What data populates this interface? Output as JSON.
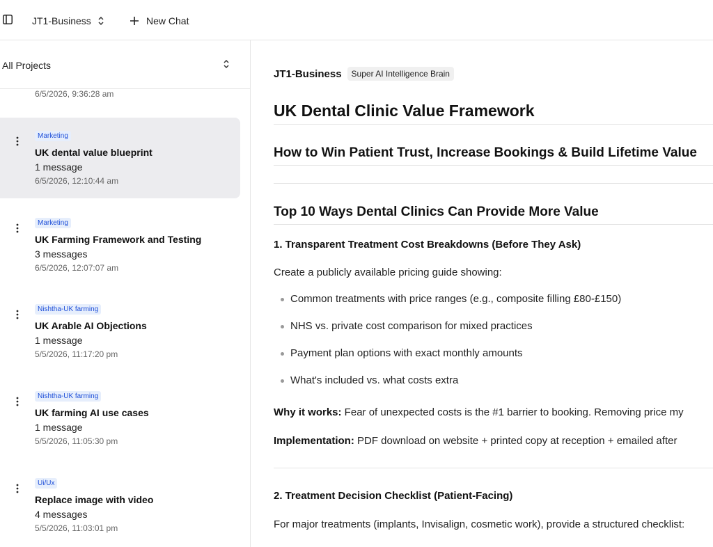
{
  "topbar": {
    "workspace": "JT1-Business",
    "new_chat_label": "New Chat"
  },
  "sidebar": {
    "project_filter": "All Projects",
    "top_partial_timestamp": "6/5/2026, 9:36:28 am",
    "items": [
      {
        "tag": "Marketing",
        "title": "UK dental value blueprint",
        "count": "1 message",
        "timestamp": "6/5/2026, 12:10:44 am",
        "selected": true
      },
      {
        "tag": "Marketing",
        "title": "UK Farming Framework and Testing",
        "count": "3 messages",
        "timestamp": "6/5/2026, 12:07:07 am",
        "selected": false
      },
      {
        "tag": "Nishtha-UK farming",
        "title": "UK Arable AI Objections",
        "count": "1 message",
        "timestamp": "5/5/2026, 11:17:20 pm",
        "selected": false
      },
      {
        "tag": "Nishtha-UK farming",
        "title": "UK farming AI use cases",
        "count": "1 message",
        "timestamp": "5/5/2026, 11:05:30 pm",
        "selected": false
      },
      {
        "tag": "Ui/Ux",
        "title": "Replace image with video",
        "count": "4 messages",
        "timestamp": "5/5/2026, 11:03:01 pm",
        "selected": false
      }
    ]
  },
  "main": {
    "workspace_name": "JT1-Business",
    "workspace_badge": "Super AI Intelligence Brain",
    "title": "UK Dental Clinic Value Framework",
    "subtitle": "How to Win Patient Trust, Increase Bookings & Build Lifetime Value",
    "section_heading": "Top 10 Ways Dental Clinics Can Provide More Value",
    "item1": {
      "heading": "1. Transparent Treatment Cost Breakdowns (Before They Ask)",
      "intro": "Create a publicly available pricing guide showing:",
      "bullets": [
        "Common treatments with price ranges (e.g., composite filling £80-£150)",
        "NHS vs. private cost comparison for mixed practices",
        "Payment plan options with exact monthly amounts",
        "What's included vs. what costs extra"
      ],
      "why_label": "Why it works:",
      "why_text": " Fear of unexpected costs is the #1 barrier to booking. Removing price my",
      "impl_label": "Implementation:",
      "impl_text": " PDF download on website + printed copy at reception + emailed after"
    },
    "item2": {
      "heading": "2. Treatment Decision Checklist (Patient-Facing)",
      "intro": "For major treatments (implants, Invisalign, cosmetic work), provide a structured checklist:"
    }
  },
  "colors": {
    "accent_tag_text": "#1d4ed8",
    "accent_tag_bg": "#e6eefc",
    "selected_bg": "#ececef"
  }
}
